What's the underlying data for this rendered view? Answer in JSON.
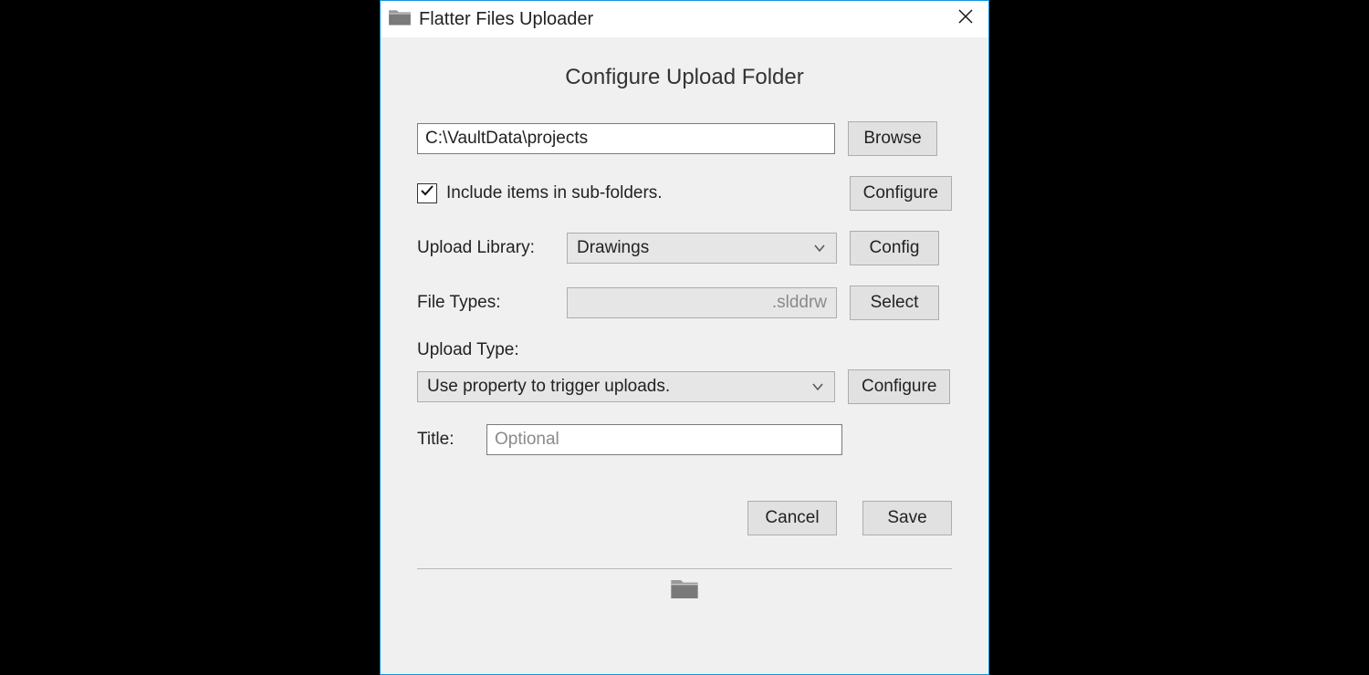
{
  "window": {
    "title": "Flatter Files Uploader"
  },
  "heading": "Configure Upload Folder",
  "folder_path": {
    "value": "C:\\VaultData\\projects"
  },
  "browse_label": "Browse",
  "include_subfolders": {
    "checked": true,
    "label": "Include items in sub-folders."
  },
  "configure_subfolders_label": "Configure",
  "library": {
    "label": "Upload Library:",
    "value": "Drawings",
    "config_label": "Config"
  },
  "file_types": {
    "label": "File Types:",
    "value": ".slddrw",
    "select_label": "Select"
  },
  "upload_type": {
    "label": "Upload Type:",
    "value": "Use property to trigger uploads.",
    "configure_label": "Configure"
  },
  "title_field": {
    "label": "Title:",
    "placeholder": "Optional",
    "value": ""
  },
  "actions": {
    "cancel": "Cancel",
    "save": "Save"
  }
}
